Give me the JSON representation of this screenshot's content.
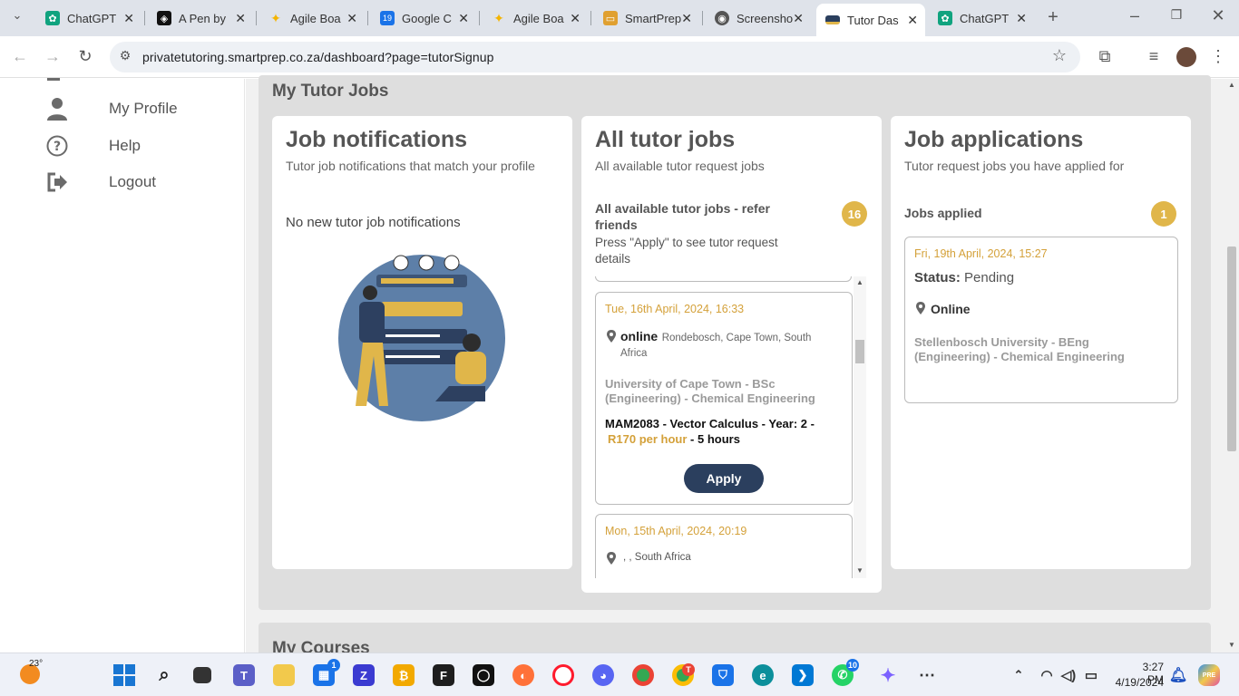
{
  "browser": {
    "tabs": [
      {
        "title": "ChatGPT",
        "icon": "chatgpt-icon",
        "color": "#10a37f",
        "glyph": "✿"
      },
      {
        "title": "A Pen by",
        "icon": "codepen-icon",
        "color": "#111111",
        "glyph": "◈"
      },
      {
        "title": "Agile Boa",
        "icon": "sparkle-icon",
        "color": "#f4b400",
        "glyph": "✦"
      },
      {
        "title": "Google C",
        "icon": "google-calendar-icon",
        "color": "#1a73e8",
        "glyph": "19"
      },
      {
        "title": "Agile Boa",
        "icon": "sparkle-icon",
        "color": "#f4b400",
        "glyph": "✦"
      },
      {
        "title": "SmartPrep",
        "icon": "smartprep-icon",
        "color": "#e0a030",
        "glyph": "▭"
      },
      {
        "title": "Screensho",
        "icon": "globe-icon",
        "color": "#555555",
        "glyph": "◉"
      },
      {
        "title": "Tutor Das",
        "icon": "tutor-dash-icon",
        "color": "#2b3f5e",
        "glyph": "▬"
      },
      {
        "title": "ChatGPT",
        "icon": "chatgpt-icon",
        "color": "#10a37f",
        "glyph": "✿"
      }
    ],
    "active_tab_index": 7,
    "url": "privatetutoring.smartprep.co.za/dashboard?page=tutorSignup"
  },
  "sidebar": {
    "items": [
      {
        "label": "My Profile",
        "icon": "user-icon"
      },
      {
        "label": "Help",
        "icon": "help-icon"
      },
      {
        "label": "Logout",
        "icon": "logout-icon"
      }
    ]
  },
  "main": {
    "section_title": "My Tutor Jobs",
    "courses_title": "My Courses",
    "notifications": {
      "title": "Job notifications",
      "subtitle": "Tutor job notifications that match your profile",
      "empty_text": "No new tutor job notifications"
    },
    "all_jobs": {
      "title": "All tutor jobs",
      "subtitle": "All available tutor request jobs",
      "list_heading": "All available tutor jobs - refer friends",
      "list_hint": "Press \"Apply\" to see tutor request details",
      "count": "16",
      "jobs": [
        {
          "date": "Tue, 16th April, 2024, 16:33",
          "mode": "online",
          "location": "Rondebosch, Cape Town, South Africa",
          "institution": "University of Cape Town - BSc (Engineering) - Chemical Engineering",
          "course": "MAM2083 - Vector Calculus - Year: 2 -",
          "rate": "R170 per hour",
          "duration": "- 5 hours",
          "apply_label": "Apply"
        },
        {
          "date": "Mon, 15th April, 2024, 20:19",
          "location": ", , South Africa"
        }
      ]
    },
    "applications": {
      "title": "Job applications",
      "subtitle": "Tutor request jobs you have applied for",
      "list_heading": "Jobs applied",
      "count": "1",
      "items": [
        {
          "date": "Fri, 19th April, 2024, 15:27",
          "status_label": "Status:",
          "status_value": "Pending",
          "mode": "Online",
          "institution": "Stellenbosch University - BEng (Engineering) - Chemical Engineering"
        }
      ]
    }
  },
  "taskbar": {
    "weather_temp": "23°",
    "time": "3:27 PM",
    "date": "4/19/2024",
    "badges": {
      "store": "1",
      "vscode_teams": "10",
      "chrome_t": "T"
    }
  },
  "colors": {
    "accent": "#2b3f5e",
    "gold": "#e0b64a",
    "date": "#d4a13a"
  }
}
